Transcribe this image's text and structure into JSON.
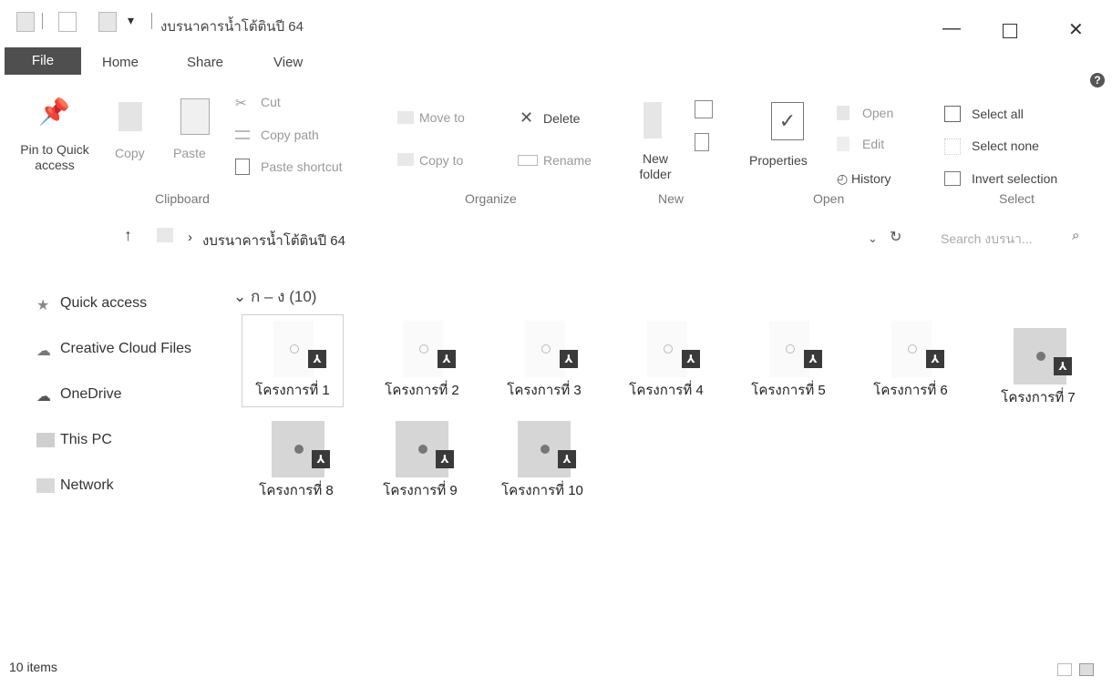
{
  "window": {
    "title": "งบรนาคารน้ำโต้ตินปี 64",
    "minimize": "—",
    "maximize": "☐",
    "close": "✕"
  },
  "ribbon": {
    "tabs": [
      "File",
      "Home",
      "Share",
      "View"
    ],
    "help": "?",
    "clipboard": {
      "pin": "Pin to Quick access",
      "copy": "Copy",
      "paste": "Paste",
      "cut": "Cut",
      "copy_path": "Copy path",
      "paste_shortcut": "Paste shortcut",
      "label": "Clipboard"
    },
    "organize": {
      "move_to": "Move to",
      "copy_to": "Copy to",
      "delete": "Delete",
      "rename": "Rename",
      "label": "Organize"
    },
    "new": {
      "new_folder": "New folder",
      "label": "New"
    },
    "open": {
      "properties": "Properties",
      "open": "Open",
      "edit": "Edit",
      "history": "History",
      "label": "Open"
    },
    "select": {
      "select_all": "Select all",
      "select_none": "Select none",
      "invert": "Invert selection",
      "label": "Select"
    }
  },
  "address": {
    "path": "งบรนาคารน้ำโต้ตินปี 64",
    "search_placeholder": "Search งบรนา..."
  },
  "nav": [
    {
      "label": "Quick access",
      "icon": "star-icon"
    },
    {
      "label": "Creative Cloud Files",
      "icon": "creative-cloud-icon"
    },
    {
      "label": "OneDrive",
      "icon": "cloud-icon"
    },
    {
      "label": "This PC",
      "icon": "computer-icon"
    },
    {
      "label": "Network",
      "icon": "network-icon"
    }
  ],
  "group_header": "ก – ง (10)",
  "files": [
    {
      "name": "โครงการที่ 1"
    },
    {
      "name": "โครงการที่ 2"
    },
    {
      "name": "โครงการที่ 3"
    },
    {
      "name": "โครงการที่ 4"
    },
    {
      "name": "โครงการที่ 5"
    },
    {
      "name": "โครงการที่ 6"
    },
    {
      "name": "โครงการที่ 7"
    },
    {
      "name": "โครงการที่ 8"
    },
    {
      "name": "โครงการที่ 9"
    },
    {
      "name": "โครงการที่ 10"
    }
  ],
  "status": {
    "items": "10 items"
  }
}
